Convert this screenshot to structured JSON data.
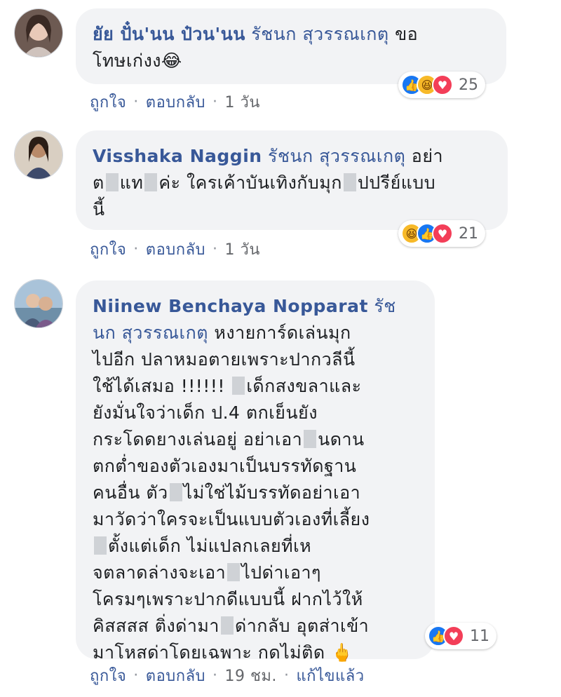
{
  "comments": [
    {
      "author": "ยัย ปั๋น'นน ป๋วน'นน",
      "tag": "รัชนก สุวรรณเกตุ",
      "text_parts": [
        " ขอ\nโทษเก่งง😂"
      ],
      "reactions": {
        "icons": [
          "like-icon",
          "haha-icon",
          "love-icon"
        ],
        "count": "25"
      },
      "actions": {
        "like": "ถูกใจ",
        "reply": "ตอบกลับ",
        "time": "1 วัน"
      }
    },
    {
      "author": "Visshaka Naggin",
      "tag": "รัชนก สุวรรณเกตุ",
      "text_parts": [
        " อย่า\nต",
        "แท",
        "ค่ะ ใครเค้าบันเทิงกับมุก",
        "ปปรีย์แบบ\nนี้"
      ],
      "reactions": {
        "icons": [
          "haha-icon",
          "like-icon",
          "love-icon"
        ],
        "count": "21"
      },
      "actions": {
        "like": "ถูกใจ",
        "reply": "ตอบกลับ",
        "time": "1 วัน"
      }
    },
    {
      "author": "Niinew Benchaya Nopparat",
      "tag": "รัชนก สุวรรณเกตุ",
      "text_parts": [
        " หงายการ์ดเล่นมุก\nไปอีก ปลาหมอตายเพราะปากวลีนี้\nใช้ได้เสมอ !!!!!! ",
        "เด็กสงขลาและ\nยังมั่นใจว่าเด็ก ป.4 ตกเย็นยัง\nกระโดดยางเล่นอยู่ อย่าเอา",
        "นดาน\nตกต่ำของตัวเองมาเป็นบรรทัดฐาน\nคนอื่น ตัว",
        "ไม่ใช่ไม้บรรทัดอย่าเอา\nมาวัดว่าใครจะเป็นแบบตัวเองที่เลี้ยง\n",
        "ตั้งแต่เด็ก ไม่แปลกเลยที่เห\nจตลาดล่างจะเอา",
        "ไปด่าเอาๆ\nโครมๆเพราะปากดีแบบนี้ ฝากไว้ให้\nคิสสสส ติ่งด่ามา",
        "ด่ากลับ อุตส่าเข้า\nมาโหสด่าโดยเฉพาะ กดไม่ติด 🖕"
      ],
      "reactions": {
        "icons": [
          "like-icon",
          "love-icon"
        ],
        "count": "11"
      },
      "actions": {
        "like": "ถูกใจ",
        "reply": "ตอบกลับ",
        "time": "19 ชม.",
        "edited": "แก้ไขแล้ว"
      }
    }
  ],
  "colors": {
    "link": "#385898",
    "bubble": "#f2f3f5",
    "meta": "#65676b",
    "like": "#1877f2",
    "love": "#f33e58",
    "haha": "#f7b928"
  }
}
